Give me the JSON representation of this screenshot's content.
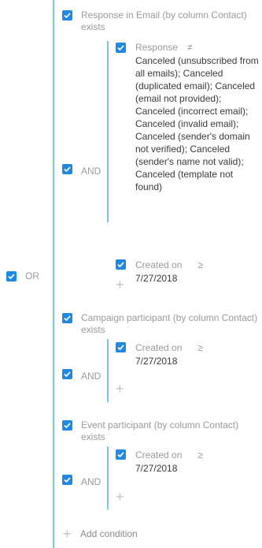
{
  "root_logic": "OR",
  "groups": [
    {
      "title": "Response in Email (by column Contact) exists",
      "logic": "AND",
      "conditions": [
        {
          "field": "Response",
          "operator": "≠",
          "value": "Canceled (unsubscribed from all emails); Canceled (duplicated email); Canceled (email not provided); Canceled (incorrect email); Canceled (invalid email); Canceled (sender's domain not verified); Canceled (sender's name not valid); Canceled (template not found)"
        },
        {
          "field": "Created on",
          "operator": "≥",
          "value": "7/27/2018"
        }
      ],
      "add_symbol": "+"
    },
    {
      "title": "Campaign participant (by column Contact) exists",
      "logic": "AND",
      "conditions": [
        {
          "field": "Created on",
          "operator": "≥",
          "value": "7/27/2018"
        }
      ],
      "add_symbol": "+"
    },
    {
      "title": "Event participant (by column Contact) exists",
      "logic": "AND",
      "conditions": [
        {
          "field": "Created on",
          "operator": "≥",
          "value": "7/27/2018"
        }
      ],
      "add_symbol": "+"
    }
  ],
  "add_condition": {
    "symbol": "+",
    "label": "Add condition"
  },
  "colors": {
    "checkbox": "#1e88e5",
    "connector_line": "#7ac3ee",
    "muted_text": "#9b9b9b",
    "primary_text": "#3a3a3a"
  }
}
